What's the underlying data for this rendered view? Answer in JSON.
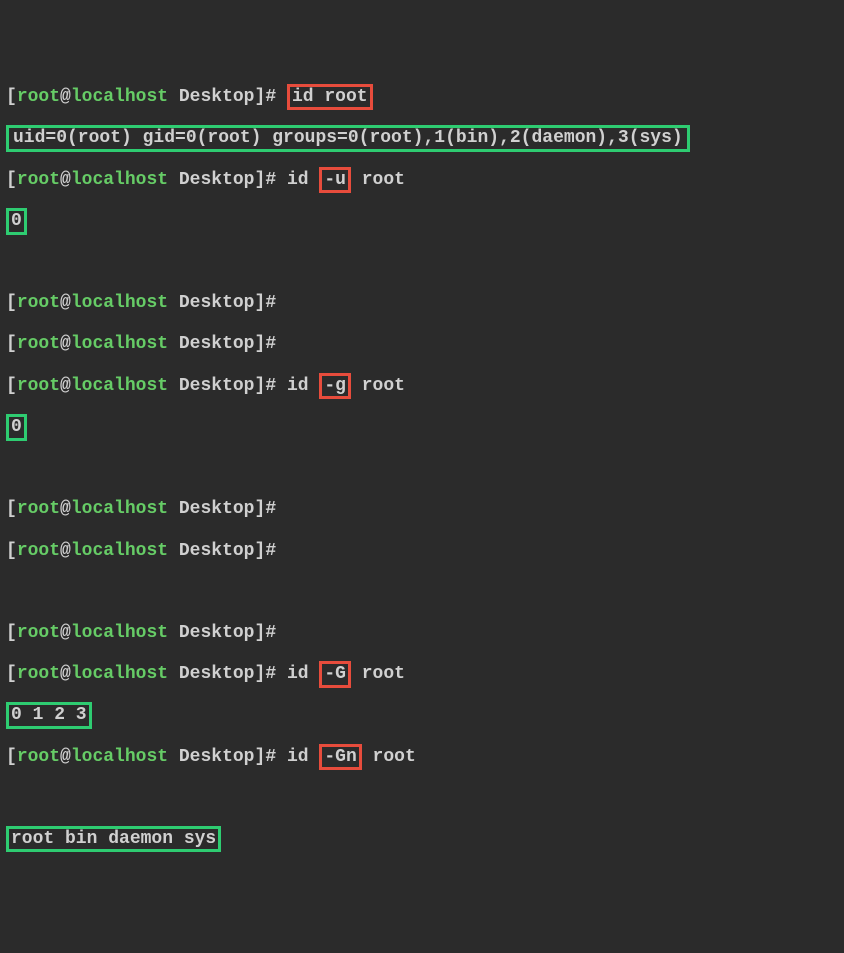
{
  "prompt": {
    "user": "root",
    "host": "localhost",
    "cwd": "Desktop",
    "symbol": "#"
  },
  "lines": {
    "l1_cmd": "id root",
    "l2_output": "uid=0(root) gid=0(root) groups=0(root),1(bin),2(daemon),3(sys)",
    "l3_cmd_pre": "id ",
    "l3_flag": "-u",
    "l3_cmd_post": " root",
    "l4_output": "0",
    "l7_cmd_pre": "id ",
    "l7_flag": "-g",
    "l7_cmd_post": " root",
    "l8_output": "0",
    "l12_cmd_pre": "id ",
    "l12_flag": "-G",
    "l12_cmd_post": " root",
    "l13_output": "0 1 2 3",
    "l14_cmd_pre": "id ",
    "l14_flag": "-Gn",
    "l14_cmd_post": " root",
    "l15_output": "root bin daemon sys"
  }
}
